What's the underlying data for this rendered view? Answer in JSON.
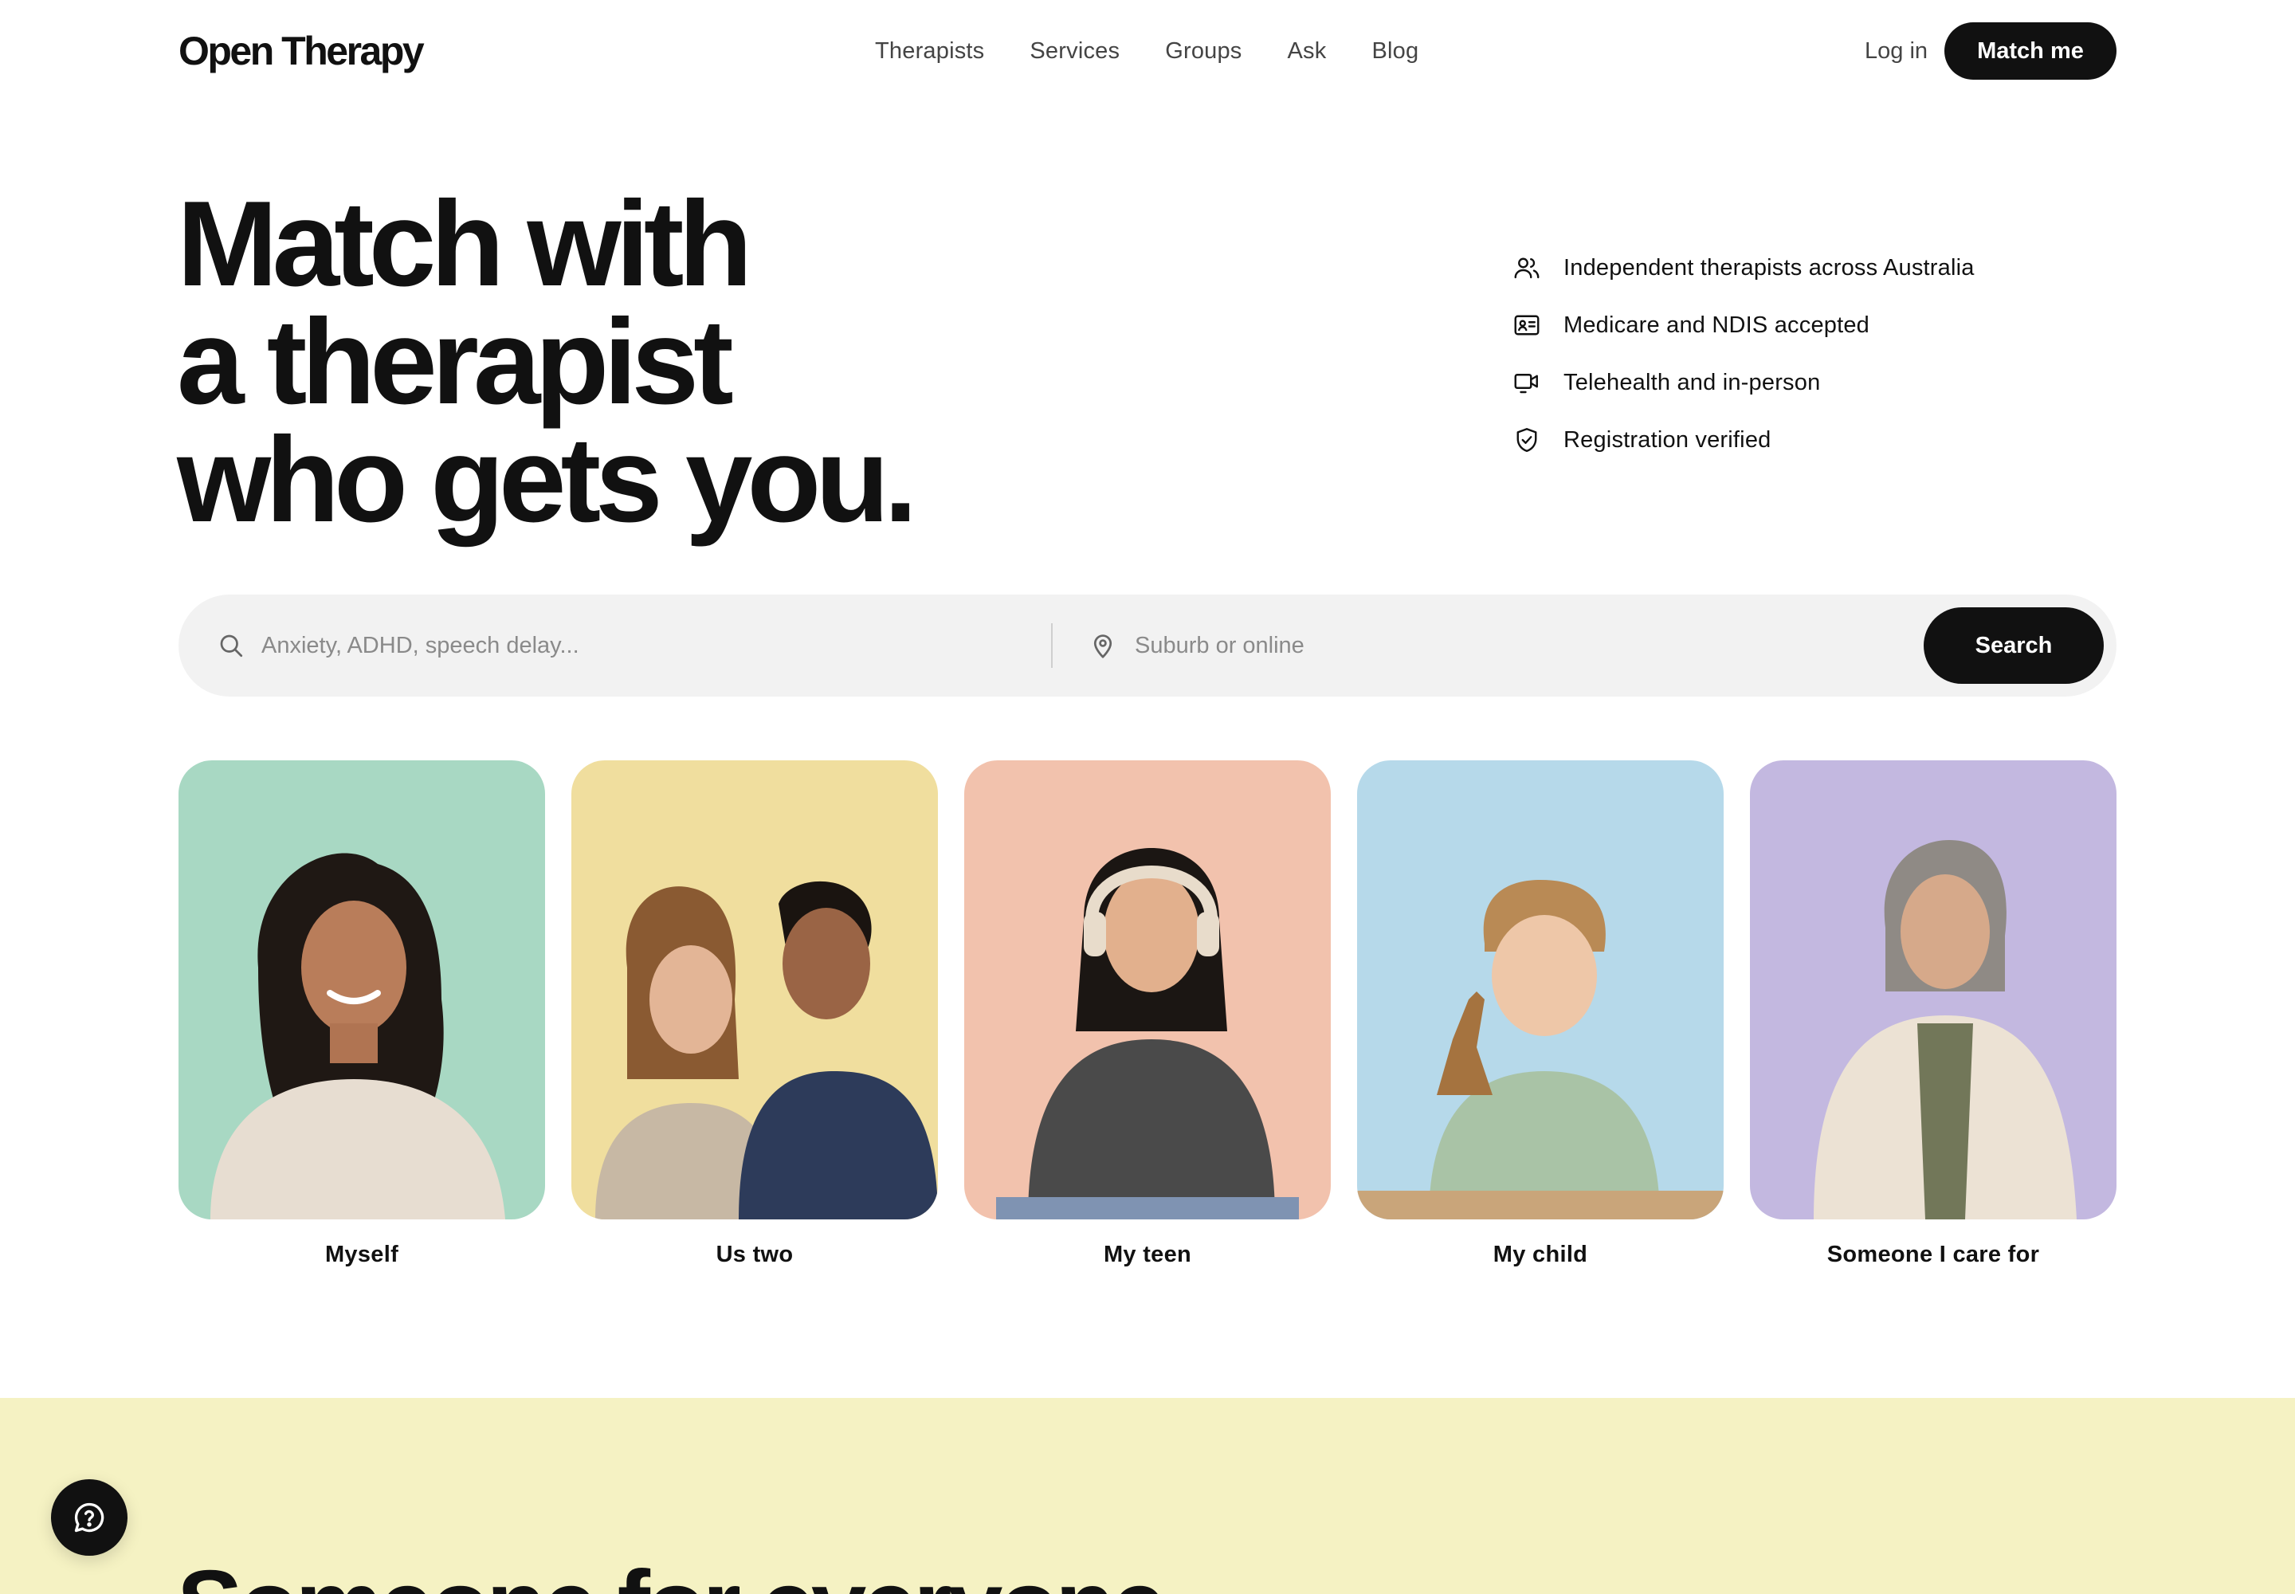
{
  "header": {
    "logo": "Open Therapy",
    "nav": [
      "Therapists",
      "Services",
      "Groups",
      "Ask",
      "Blog"
    ],
    "login": "Log in",
    "cta": "Match me"
  },
  "hero": {
    "title_lines": [
      "Match with",
      "a therapist",
      "who gets you."
    ]
  },
  "features": [
    {
      "icon": "people-icon",
      "text": "Independent therapists across Australia"
    },
    {
      "icon": "id-card-icon",
      "text": "Medicare and NDIS accepted"
    },
    {
      "icon": "video-icon",
      "text": "Telehealth and in-person"
    },
    {
      "icon": "shield-check-icon",
      "text": "Registration verified"
    }
  ],
  "search": {
    "query_placeholder": "Anxiety, ADHD, speech delay...",
    "location_placeholder": "Suburb or online",
    "button": "Search"
  },
  "cards": [
    {
      "label": "Myself",
      "bg": "#a8d8c3"
    },
    {
      "label": "Us two",
      "bg": "#f0de9e"
    },
    {
      "label": "My teen",
      "bg": "#f2c2ad"
    },
    {
      "label": "My child",
      "bg": "#b6d9ea"
    },
    {
      "label": "Someone I care for",
      "bg": "#c3b8e0"
    }
  ],
  "band": {
    "title": "Someone for everyone",
    "bg": "#f5f2c3"
  },
  "colors": {
    "accent": "#111111",
    "search_bg": "#f2f2f2"
  }
}
